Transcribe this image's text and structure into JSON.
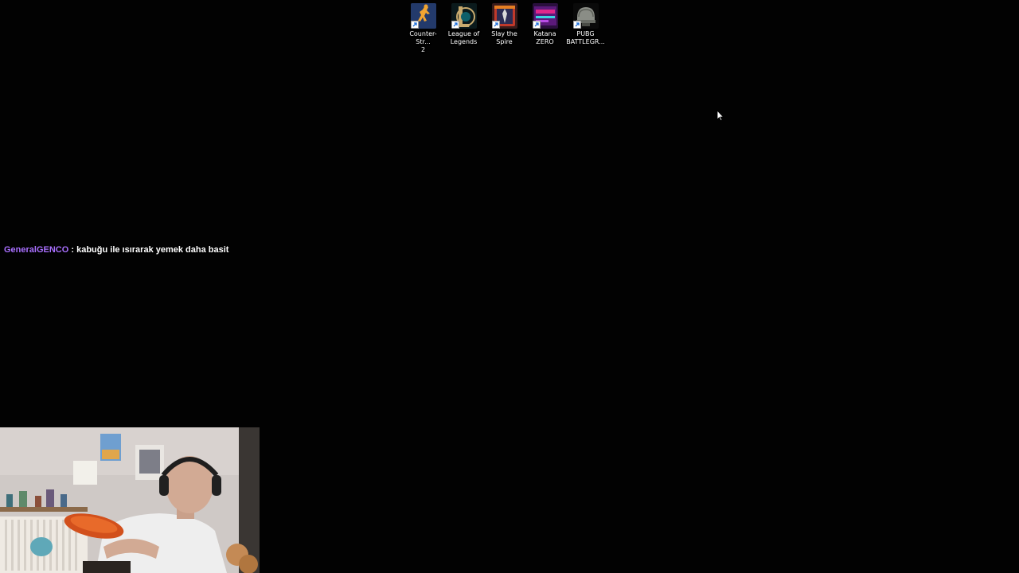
{
  "desktop": {
    "background_color": "#020202",
    "icons": [
      {
        "label": "Counter-Str...\n2",
        "line1": "Counter-Str...",
        "line2": "2",
        "icon": "counter-strike-icon"
      },
      {
        "label": "League of Legends",
        "line1": "League of",
        "line2": "Legends",
        "icon": "league-of-legends-icon"
      },
      {
        "label": "Slay the Spire",
        "line1": "Slay the Spire",
        "line2": "",
        "icon": "slay-the-spire-icon"
      },
      {
        "label": "Katana ZERO",
        "line1": "Katana ZERO",
        "line2": "",
        "icon": "katana-zero-icon"
      },
      {
        "label": "PUBG BATTLEGR...",
        "line1": "PUBG",
        "line2": "BATTLEGR...",
        "icon": "pubg-icon"
      }
    ]
  },
  "chat": {
    "username": "GeneralGENCO",
    "separator": " : ",
    "message": "kabuğu ile ısırarak yemek daha basit",
    "username_color": "#a970ff"
  },
  "webcam": {
    "icon": "webcam-overlay"
  }
}
